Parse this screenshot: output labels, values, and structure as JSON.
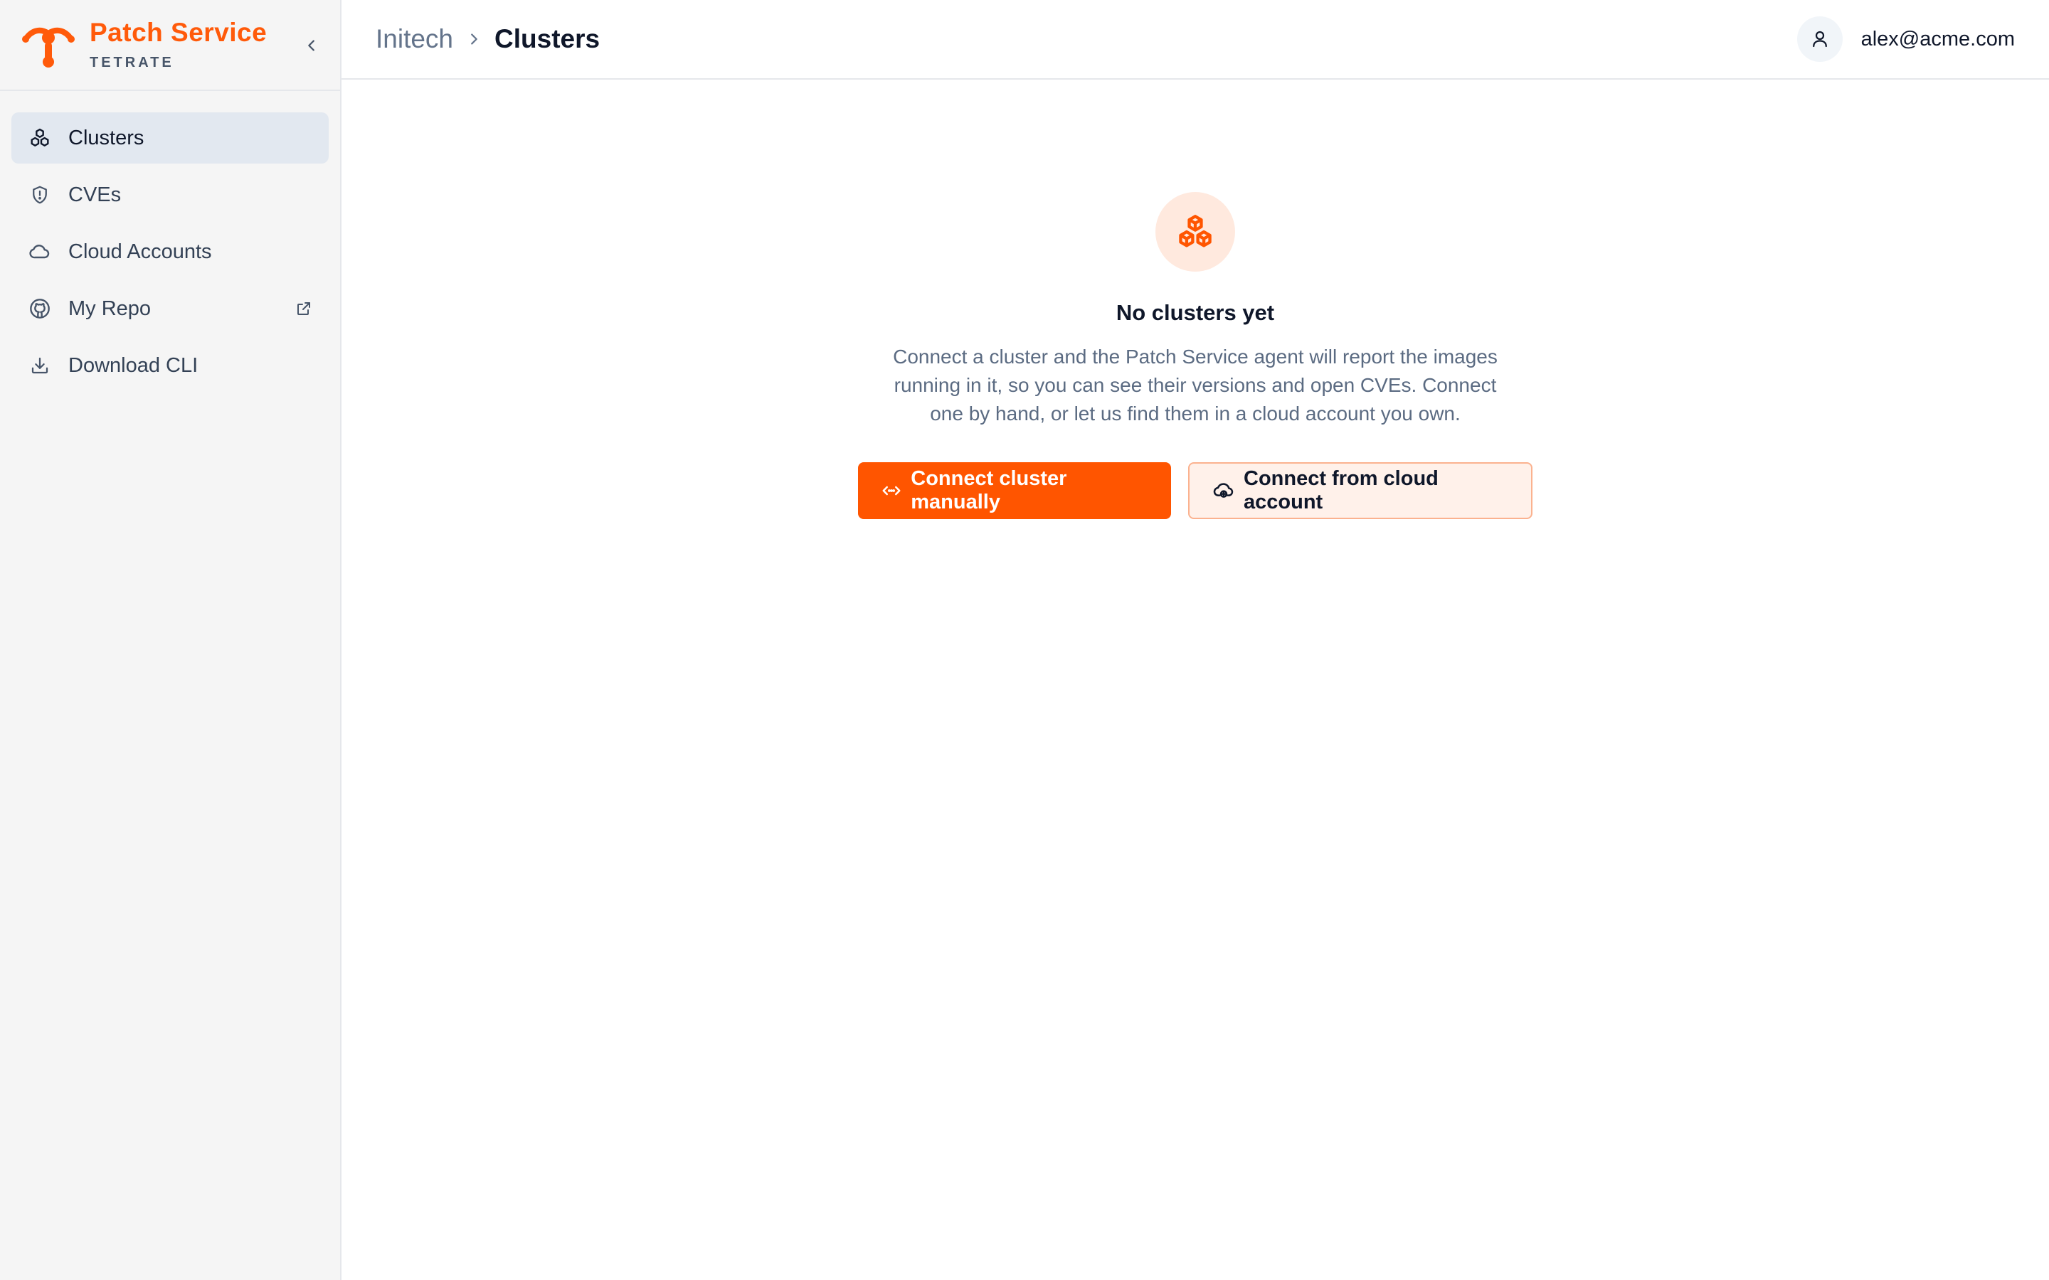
{
  "brand": {
    "title": "Patch Service",
    "subtitle": "TETRATE",
    "color": "#ff5a0a",
    "logo_icon": "tetrate-logo-icon",
    "collapse_icon": "chevron-left-icon"
  },
  "sidebar": {
    "items": [
      {
        "label": "Clusters",
        "icon": "clusters-icon",
        "active": true
      },
      {
        "label": "CVEs",
        "icon": "shield-alert-icon",
        "active": false
      },
      {
        "label": "Cloud Accounts",
        "icon": "cloud-icon",
        "active": false
      },
      {
        "label": "My Repo",
        "icon": "github-icon",
        "active": false,
        "external": true
      },
      {
        "label": "Download CLI",
        "icon": "download-icon",
        "active": false
      }
    ]
  },
  "header": {
    "breadcrumb": {
      "parent": "Initech",
      "current": "Clusters"
    },
    "user": {
      "email": "alex@acme.com",
      "icon": "user-icon"
    }
  },
  "empty_state": {
    "icon": "clusters-icon",
    "title": "No clusters yet",
    "description": "Connect a cluster and the Patch Service agent will report the images running in it, so you can see their versions and open CVEs. Connect one by hand, or let us find them in a cloud account you own.",
    "primary_button": {
      "label": "Connect cluster manually",
      "icon": "code-icon"
    },
    "secondary_button": {
      "label": "Connect from cloud account",
      "icon": "cloud-upload-icon"
    }
  },
  "colors": {
    "accent": "#ff5500",
    "accent_soft": "#ffe9de",
    "sidebar_bg": "#f5f5f5",
    "active_bg": "#e2e8f0"
  }
}
